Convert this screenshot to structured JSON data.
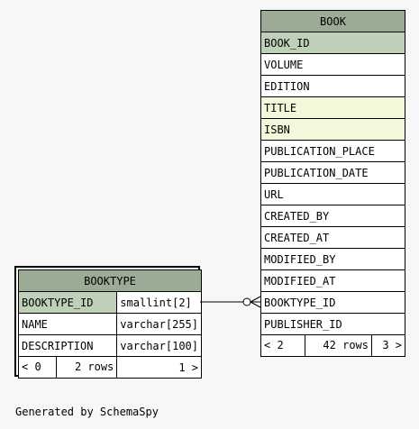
{
  "book": {
    "name": "BOOK",
    "columns": [
      "BOOK_ID",
      "VOLUME",
      "EDITION",
      "TITLE",
      "ISBN",
      "PUBLICATION_PLACE",
      "PUBLICATION_DATE",
      "URL",
      "CREATED_BY",
      "CREATED_AT",
      "MODIFIED_BY",
      "MODIFIED_AT",
      "BOOKTYPE_ID",
      "PUBLISHER_ID"
    ],
    "footer": {
      "parents": "< 2",
      "rows": "42 rows",
      "children": "3 >"
    }
  },
  "booktype": {
    "name": "BOOKTYPE",
    "columns": [
      {
        "name": "BOOKTYPE_ID",
        "type": "smallint[2]"
      },
      {
        "name": "NAME",
        "type": "varchar[255]"
      },
      {
        "name": "DESCRIPTION",
        "type": "varchar[100]"
      }
    ],
    "footer": {
      "parents": "< 0",
      "rows": "2 rows",
      "children": "1 >"
    }
  },
  "colors": {
    "header": "#9bab96",
    "primary_key": "#bed1b8",
    "indexed": "#f4f7da"
  },
  "generated_by": "Generated by SchemaSpy"
}
